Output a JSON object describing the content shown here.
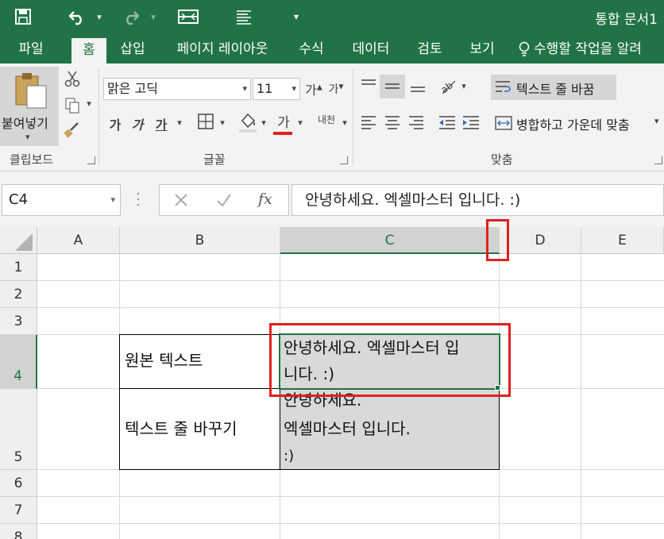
{
  "window": {
    "title": "통합 문서1"
  },
  "quick_access": {
    "save_icon": "save-icon",
    "undo_icon": "undo-icon",
    "redo_icon": "redo-icon"
  },
  "tabs": [
    {
      "label": "파일",
      "active": false
    },
    {
      "label": "홈",
      "active": true
    },
    {
      "label": "삽입",
      "active": false
    },
    {
      "label": "페이지 레이아웃",
      "active": false
    },
    {
      "label": "수식",
      "active": false
    },
    {
      "label": "데이터",
      "active": false
    },
    {
      "label": "검토",
      "active": false
    },
    {
      "label": "보기",
      "active": false
    }
  ],
  "tell_me": "수행할 작업을 알려",
  "clipboard": {
    "paste_label": "붙여넣기",
    "group_label": "클립보드"
  },
  "font": {
    "font_name": "맑은 고딕",
    "font_size": "11",
    "group_label": "글꼴",
    "bold": "가",
    "italic": "가",
    "underline": "가",
    "grow": "가",
    "shrink": "가",
    "font_color": "가",
    "phonetic": "내천"
  },
  "alignment": {
    "wrap_text": "텍스트 줄 바꿈",
    "merge_center": "병합하고 가운데 맞춤",
    "group_label": "맞춤"
  },
  "formula_bar": {
    "name_box": "C4",
    "fx": "fx",
    "formula": "안녕하세요. 엑셀마스터 입니다. :)"
  },
  "columns": [
    "A",
    "B",
    "C",
    "D",
    "E"
  ],
  "rows": [
    "1",
    "2",
    "3",
    "4",
    "5",
    "6",
    "7",
    "8"
  ],
  "cells": {
    "B4": "원본 텍스트",
    "C4_line1": "안녕하세요. 엑셀마스터 입",
    "C4_line2": "니다. :)",
    "B5": "텍스트 줄 바꾸기",
    "C5_line1": "안녕하세요.",
    "C5_line2": "엑셀마스터 입니다.",
    "C5_line3": ":)"
  },
  "colors": {
    "brand": "#217346",
    "highlight": "#e02020",
    "cell_fill": "#d9d9d9"
  }
}
